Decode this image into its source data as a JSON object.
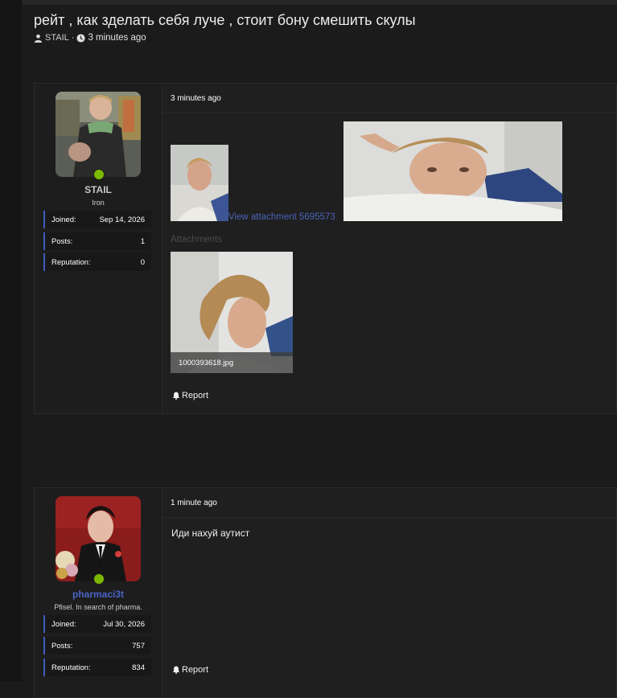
{
  "thread": {
    "title": "рейт , как зделать себя луче , стоит бону смешить скулы",
    "author": "STAIL",
    "separator": "·",
    "time": "3 minutes ago"
  },
  "posts": [
    {
      "username": "STAIL",
      "username_color": "#c8c8c8",
      "user_title": "Iron",
      "stats": [
        {
          "label": "Joined:",
          "value": "Sep 14, 2026"
        },
        {
          "label": "Posts:",
          "value": "1"
        },
        {
          "label": "Reputation:",
          "value": "0"
        }
      ],
      "time": "3 minutes ago",
      "attachment_link": "View attachment 5695573",
      "attachments_heading": "Attachments",
      "attachment_file": "1000393618.jpg",
      "report_label": "Report"
    },
    {
      "username": "pharmaci3t",
      "username_color": "#4a63c8",
      "user_title": "Pfisel. In search of pharma.",
      "stats": [
        {
          "label": "Joined:",
          "value": "Jul 30, 2026"
        },
        {
          "label": "Posts:",
          "value": "757"
        },
        {
          "label": "Reputation:",
          "value": "834"
        }
      ],
      "time": "1 minute ago",
      "message": "Иди нахуй аутист",
      "report_label": "Report"
    }
  ],
  "colors": {
    "online": "#7cb800",
    "accent": "#3e5bbf"
  }
}
